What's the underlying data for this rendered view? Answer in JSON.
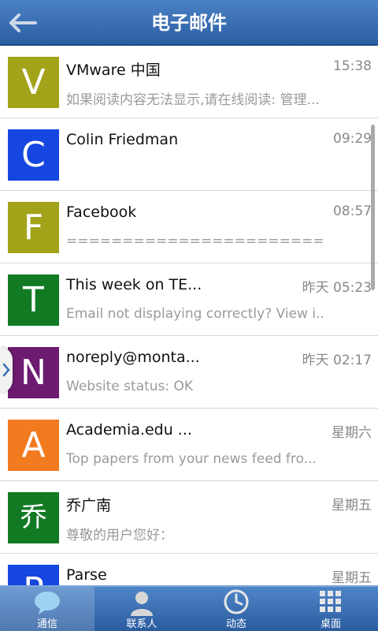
{
  "header": {
    "title": "电子邮件",
    "back_icon": "back-arrow-icon"
  },
  "colors": {
    "header": "#2c5fa3",
    "olive": "#a3a31a",
    "blue": "#1546e0",
    "green": "#137a24",
    "purple": "#6c1b70",
    "orange": "#f27a1f"
  },
  "emails": [
    {
      "letter": "V",
      "sender": "VMware 中国",
      "time": "15:38",
      "preview": "如果阅读内容无法显示,请在线阅读: 管理...",
      "color": "#a3a31a"
    },
    {
      "letter": "C",
      "sender": "Colin Friedman",
      "time": "09:29",
      "preview": "",
      "color": "#1546e0"
    },
    {
      "letter": "F",
      "sender": "Facebook",
      "time": "08:57",
      "preview": "===============================...",
      "color": "#a3a31a"
    },
    {
      "letter": "T",
      "sender": "This week on TE...",
      "time": "昨天 05:23",
      "preview": "Email not displaying correctly? View i...",
      "color": "#137a24"
    },
    {
      "letter": "N",
      "sender": "noreply@monta...",
      "time": "昨天 02:17",
      "preview": "Website status: OK",
      "color": "#6c1b70"
    },
    {
      "letter": "A",
      "sender": "Academia.edu ...",
      "time": "星期六",
      "preview": "Top papers from your news feed fro...",
      "color": "#f27a1f"
    },
    {
      "letter": "乔",
      "sender": "乔广南",
      "time": "星期五",
      "preview": "尊敬的用户您好：",
      "color": "#137a24"
    },
    {
      "letter": "P",
      "sender": "Parse",
      "time": "星期五",
      "preview": "",
      "color": "#1546e0"
    }
  ],
  "tabs": [
    {
      "label": "通信",
      "icon": "chat-bubble-icon",
      "active": true
    },
    {
      "label": "联系人",
      "icon": "person-icon",
      "active": false
    },
    {
      "label": "动态",
      "icon": "clock-icon",
      "active": false
    },
    {
      "label": "桌面",
      "icon": "grid-icon",
      "active": false
    }
  ]
}
